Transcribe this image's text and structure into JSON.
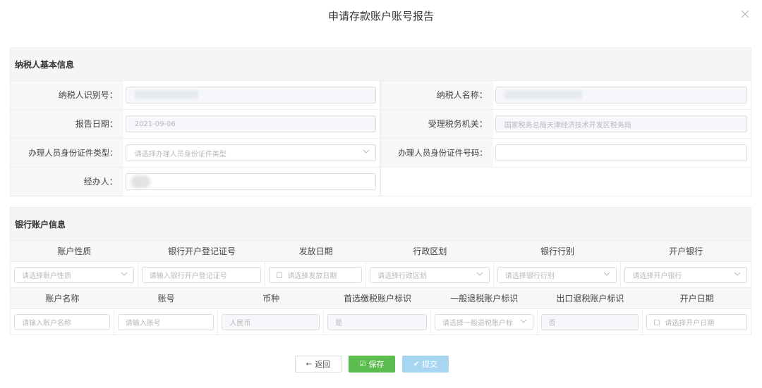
{
  "dialog": {
    "title": "申请存款账户账号报告"
  },
  "taxpayer": {
    "section_title": "纳税人基本信息",
    "id_label": "纳税人识别号：",
    "name_label": "纳税人名称：",
    "report_date_label": "报告日期：",
    "report_date_value": "2021-09-06",
    "tax_office_label": "受理税务机关：",
    "tax_office_value": "国家税务总局天津经济技术开发区税务局",
    "id_type_label": "办理人员身份证件类型：",
    "id_type_placeholder": "请选择办理人员身份证件类型",
    "id_number_label": "办理人员身份证件号码：",
    "handler_label": "经办人："
  },
  "bank": {
    "section_title": "银行账户信息",
    "headers1": [
      "账户性质",
      "银行开户登记证号",
      "发放日期",
      "行政区划",
      "银行行别",
      "开户银行"
    ],
    "row1": {
      "nature_placeholder": "请选择账户性质",
      "reg_no_placeholder": "请输入银行开户登记证号",
      "issue_date_placeholder": "请选择发放日期",
      "region_placeholder": "请选择行政区划",
      "bank_type_placeholder": "请选择银行行别",
      "open_bank_placeholder": "请选择开户银行"
    },
    "headers2": [
      "账户名称",
      "账号",
      "币种",
      "首选缴税账户标识",
      "一般退税账户标识",
      "出口退税账户标识",
      "开户日期"
    ],
    "row2": {
      "account_name_placeholder": "请输入账户名称",
      "account_no_placeholder": "请输入账号",
      "currency_value": "人民币",
      "preferred_value": "是",
      "general_refund_placeholder": "请选择一般退税账户标",
      "export_refund_value": "否",
      "open_date_placeholder": "请选择开户日期"
    }
  },
  "actions": {
    "back_label": "返回",
    "save_label": "保存",
    "submit_label": "提交"
  }
}
